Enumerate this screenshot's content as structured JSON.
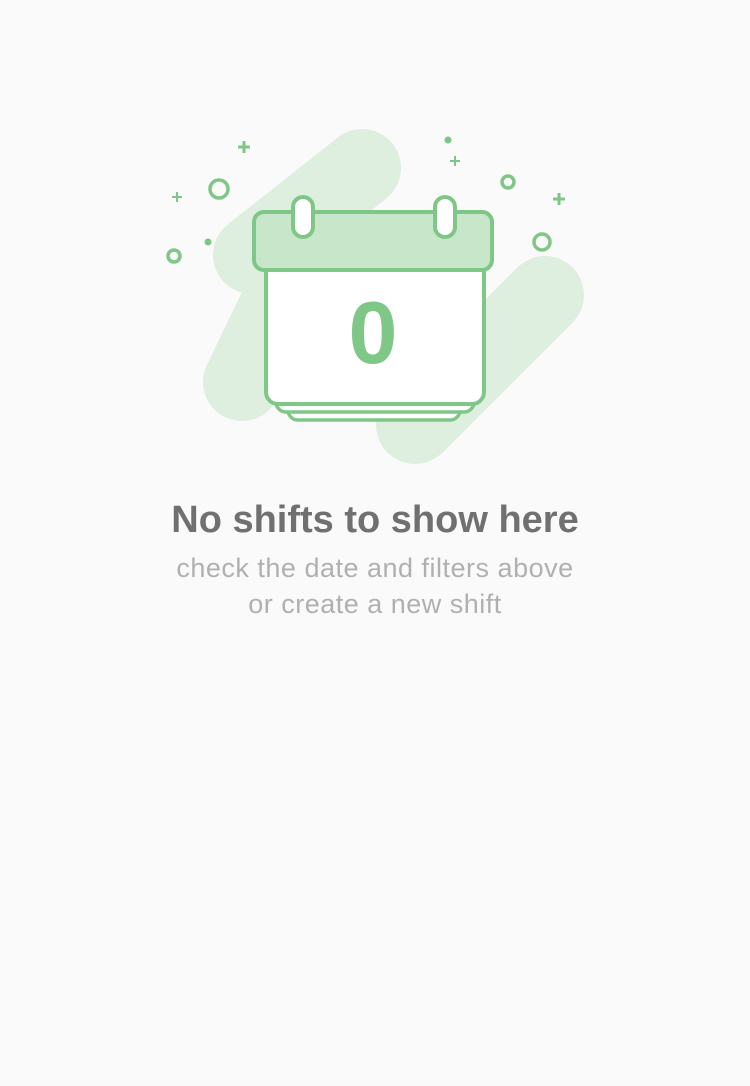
{
  "empty_state": {
    "icon": "calendar-zero-icon",
    "calendar_number": "0",
    "title": "No shifts to show here",
    "subtitle_line1": "check the date and filters above",
    "subtitle_line2": "or create a new shift"
  },
  "colors": {
    "background": "#fafafa",
    "accent": "#7fc786",
    "accent_light": "#c8e6c9",
    "accent_faint": "#deefe0",
    "title": "#707070",
    "subtitle": "#b0b0b0"
  }
}
